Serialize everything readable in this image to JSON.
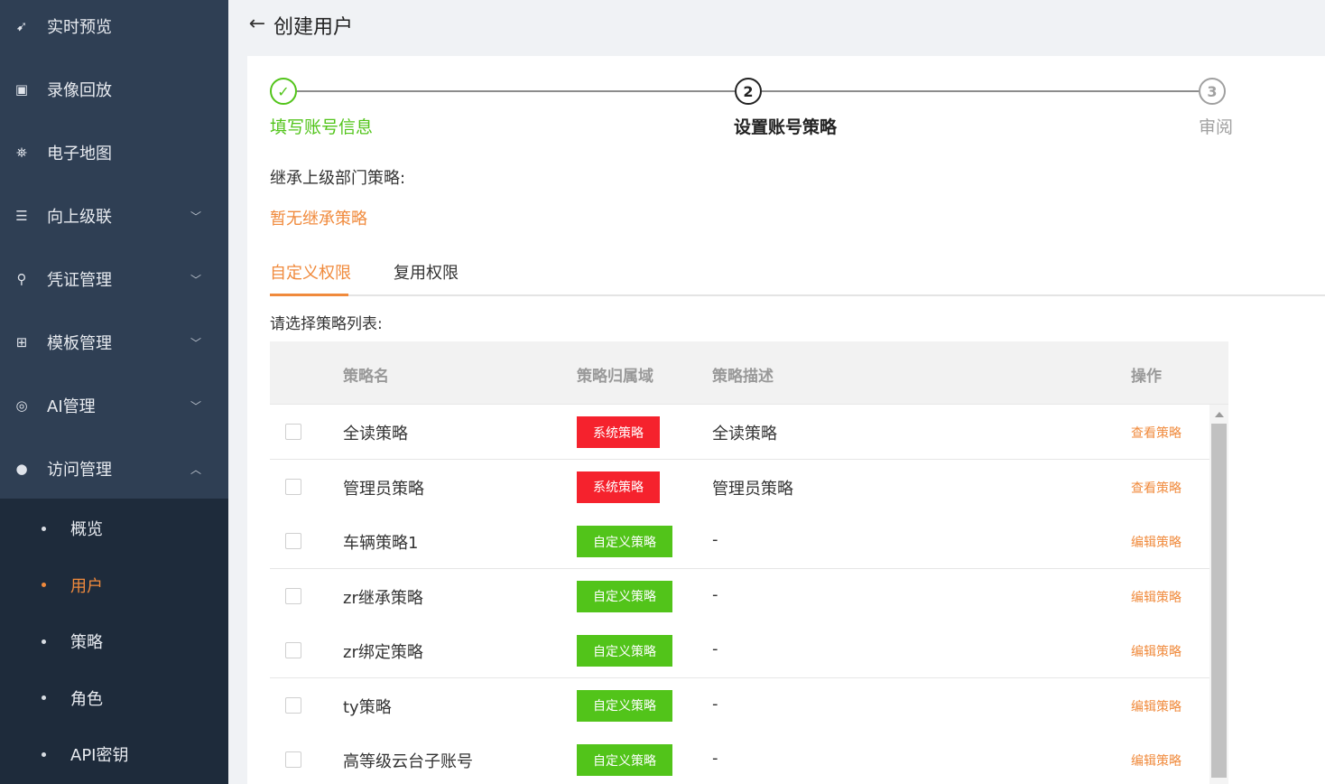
{
  "sidebar": {
    "menu": [
      {
        "label": "实时预览",
        "icon": "live-icon",
        "glyph": "➹",
        "expandable": false
      },
      {
        "label": "录像回放",
        "icon": "playback-icon",
        "glyph": "▣",
        "expandable": false
      },
      {
        "label": "电子地图",
        "icon": "map-icon",
        "glyph": "⛯",
        "expandable": false
      },
      {
        "label": "向上级联",
        "icon": "cascade-icon",
        "glyph": "☰",
        "expandable": true
      },
      {
        "label": "凭证管理",
        "icon": "key-icon",
        "glyph": "⚲",
        "expandable": true
      },
      {
        "label": "模板管理",
        "icon": "template-icon",
        "glyph": "⊞",
        "expandable": true
      },
      {
        "label": "AI管理",
        "icon": "ai-icon",
        "glyph": "◎",
        "expandable": true
      },
      {
        "label": "访问管理",
        "icon": "user-icon",
        "glyph": "●",
        "expandable": true,
        "expanded": true
      }
    ],
    "submenu": [
      {
        "label": "概览",
        "active": false
      },
      {
        "label": "用户",
        "active": true
      },
      {
        "label": "策略",
        "active": false
      },
      {
        "label": "角色",
        "active": false
      },
      {
        "label": "API密钥",
        "active": false
      }
    ]
  },
  "header": {
    "back_icon": "←",
    "title": "创建用户"
  },
  "steps": [
    {
      "label": "填写账号信息",
      "status": "done",
      "glyph": "✓"
    },
    {
      "label": "设置账号策略",
      "status": "current",
      "glyph": "2"
    },
    {
      "label": "审阅",
      "status": "pending",
      "glyph": "3"
    }
  ],
  "inherit": {
    "label": "继承上级部门策略:",
    "value": "暂无继承策略"
  },
  "tabs": [
    {
      "label": "自定义权限",
      "active": true
    },
    {
      "label": "复用权限",
      "active": false
    }
  ],
  "select_label": "请选择策略列表:",
  "table": {
    "headers": {
      "name": "策略名",
      "domain": "策略归属域",
      "desc": "策略描述",
      "op": "操作"
    },
    "rows": [
      {
        "name": "全读策略",
        "domain": "系统策略",
        "domain_type": "system",
        "desc": "全读策略",
        "op": "查看策略"
      },
      {
        "name": "管理员策略",
        "domain": "系统策略",
        "domain_type": "system",
        "desc": "管理员策略",
        "op": "查看策略"
      },
      {
        "name": "车辆策略1",
        "domain": "自定义策略",
        "domain_type": "custom",
        "desc": "-",
        "op": "编辑策略"
      },
      {
        "name": "zr继承策略",
        "domain": "自定义策略",
        "domain_type": "custom",
        "desc": "-",
        "op": "编辑策略"
      },
      {
        "name": "zr绑定策略",
        "domain": "自定义策略",
        "domain_type": "custom",
        "desc": "-",
        "op": "编辑策略"
      },
      {
        "name": "ty策略",
        "domain": "自定义策略",
        "domain_type": "custom",
        "desc": "-",
        "op": "编辑策略"
      },
      {
        "name": "高等级云台子账号",
        "domain": "自定义策略",
        "domain_type": "custom",
        "desc": "-",
        "op": "编辑策略"
      }
    ]
  },
  "colors": {
    "accent": "#f08a3c",
    "success": "#52c41a",
    "system_tag": "#f5222d",
    "custom_tag": "#52c41a",
    "sidebar_bg": "#2f3f54",
    "submenu_bg": "#1e2b3b"
  }
}
